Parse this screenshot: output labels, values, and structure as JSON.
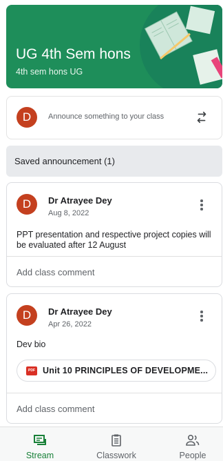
{
  "class_banner": {
    "title": "UG 4th Sem hons",
    "subtitle": "4th sem hons UG",
    "color": "#1e8e5a"
  },
  "announce": {
    "avatar_initial": "D",
    "placeholder": "Announce something to your class",
    "repost_icon": "repost-icon"
  },
  "saved": {
    "label": "Saved announcement (1)"
  },
  "posts": [
    {
      "avatar_initial": "D",
      "author": "Dr Atrayee Dey",
      "date": "Aug 8, 2022",
      "body": "PPT presentation and respective project copies will be evaluated after 12 August",
      "comment_placeholder": "Add class comment"
    },
    {
      "avatar_initial": "D",
      "author": "Dr Atrayee Dey",
      "date": "Apr 26, 2022",
      "body": "Dev bio",
      "attachment": {
        "icon_label": "PDF",
        "name": "Unit 10 PRINCIPLES OF DEVELOPME..."
      },
      "comment_placeholder": "Add class comment"
    }
  ],
  "bottom_nav": [
    {
      "label": "Stream",
      "icon": "stream-icon",
      "active": true
    },
    {
      "label": "Classwork",
      "icon": "classwork-icon",
      "active": false
    },
    {
      "label": "People",
      "icon": "people-icon",
      "active": false
    }
  ],
  "colors": {
    "avatar": "#c4401f",
    "active_nav": "#188038",
    "pdf": "#d93025"
  }
}
